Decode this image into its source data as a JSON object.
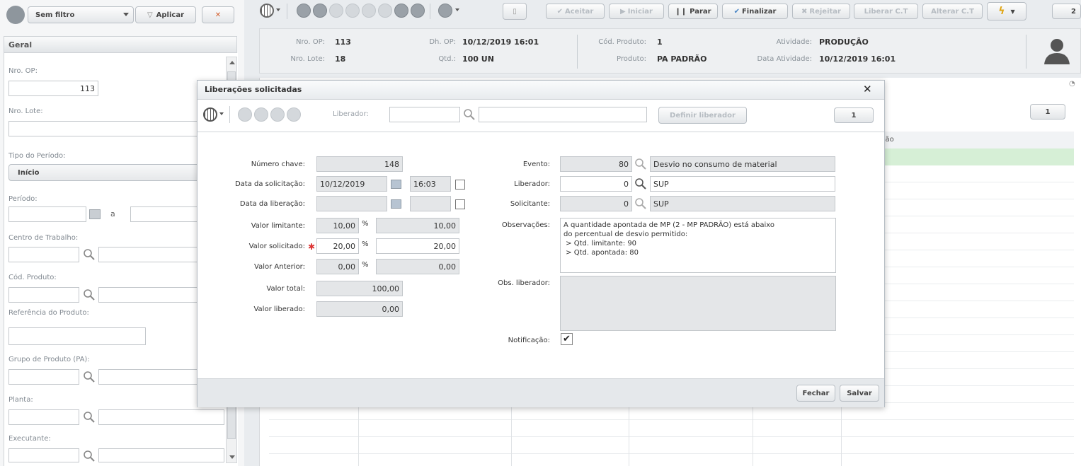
{
  "filterbar": {
    "filter_select": "Sem filtro",
    "apply": "Aplicar"
  },
  "left": {
    "section": "Geral",
    "nro_op_label": "Nro. OP:",
    "nro_op_value": "113",
    "nro_lote_label": "Nro. Lote:",
    "tipo_periodo_label": "Tipo do Período:",
    "tipo_periodo_value": "Início",
    "periodo_label": "Período:",
    "periodo_sep": "a",
    "centro_label": "Centro de Trabalho:",
    "cod_produto_label": "Cód. Produto:",
    "ref_produto_label": "Referência do Produto:",
    "grupo_label": "Grupo de Produto (PA):",
    "planta_label": "Planta:",
    "executante_label": "Executante:"
  },
  "toolbar": {
    "aceitar": "Aceitar",
    "iniciar": "Iniciar",
    "parar": "Parar",
    "finalizar": "Finalizar",
    "rejeitar": "Rejeitar",
    "liberar_ct": "Liberar C.T",
    "alterar_ct": "Alterar C.T",
    "page": "2"
  },
  "header": {
    "nro_op_k": "Nro. OP:",
    "nro_op_v": "113",
    "nro_lote_k": "Nro. Lote:",
    "nro_lote_v": "18",
    "dh_op_k": "Dh. OP:",
    "dh_op_v": "10/12/2019 16:01",
    "qtd_k": "Qtd.:",
    "qtd_v": "100  UN",
    "cod_prod_k": "Cód. Produto:",
    "cod_prod_v": "1",
    "produto_k": "Produto:",
    "produto_v": "PA PADRÃO",
    "atividade_k": "Atividade:",
    "atividade_v": "PRODUÇÃO",
    "data_ativ_k": "Data Atividade:",
    "data_ativ_v": "10/12/2019 16:01"
  },
  "bg": {
    "page_badge": "1",
    "col_partial": "ção"
  },
  "dialog": {
    "title": "Liberações solicitadas",
    "liberador_label": "Liberador:",
    "definir": "Definir liberador",
    "page": "1",
    "numero_chave_k": "Número chave:",
    "numero_chave_v": "148",
    "data_sol_k": "Data da solicitação:",
    "data_sol_v": "10/12/2019",
    "hora_sol_v": "16:03",
    "data_lib_k": "Data da liberação:",
    "valor_lim_k": "Valor limitante:",
    "valor_lim_pct": "10,00",
    "valor_lim_v": "10,00",
    "valor_sol_k": "Valor solicitado:",
    "valor_sol_pct": "20,00",
    "valor_sol_v": "20,00",
    "valor_ant_k": "Valor Anterior:",
    "valor_ant_pct": "0,00",
    "valor_ant_v": "0,00",
    "pct": "%",
    "valor_total_k": "Valor total:",
    "valor_total_v": "100,00",
    "valor_lib_k": "Valor liberado:",
    "valor_lib_v": "0,00",
    "evento_k": "Evento:",
    "evento_code": "80",
    "evento_desc": "Desvio no consumo de material",
    "liberador_k": "Liberador:",
    "liberador_code": "0",
    "liberador_desc": "SUP",
    "solicitante_k": "Solicitante:",
    "solicitante_code": "0",
    "solicitante_desc": "SUP",
    "obs_k": "Observações:",
    "obs_lines": [
      "A quantidade apontada de MP (2 - MP PADRÃO) está abaixo",
      "do percentual de desvio permitido:",
      " > Qtd. limitante: 90",
      " > Qtd. apontada: 80"
    ],
    "obs_lib_k": "Obs. liberador:",
    "notif_k": "Notificação:",
    "fechar": "Fechar",
    "salvar": "Salvar"
  }
}
